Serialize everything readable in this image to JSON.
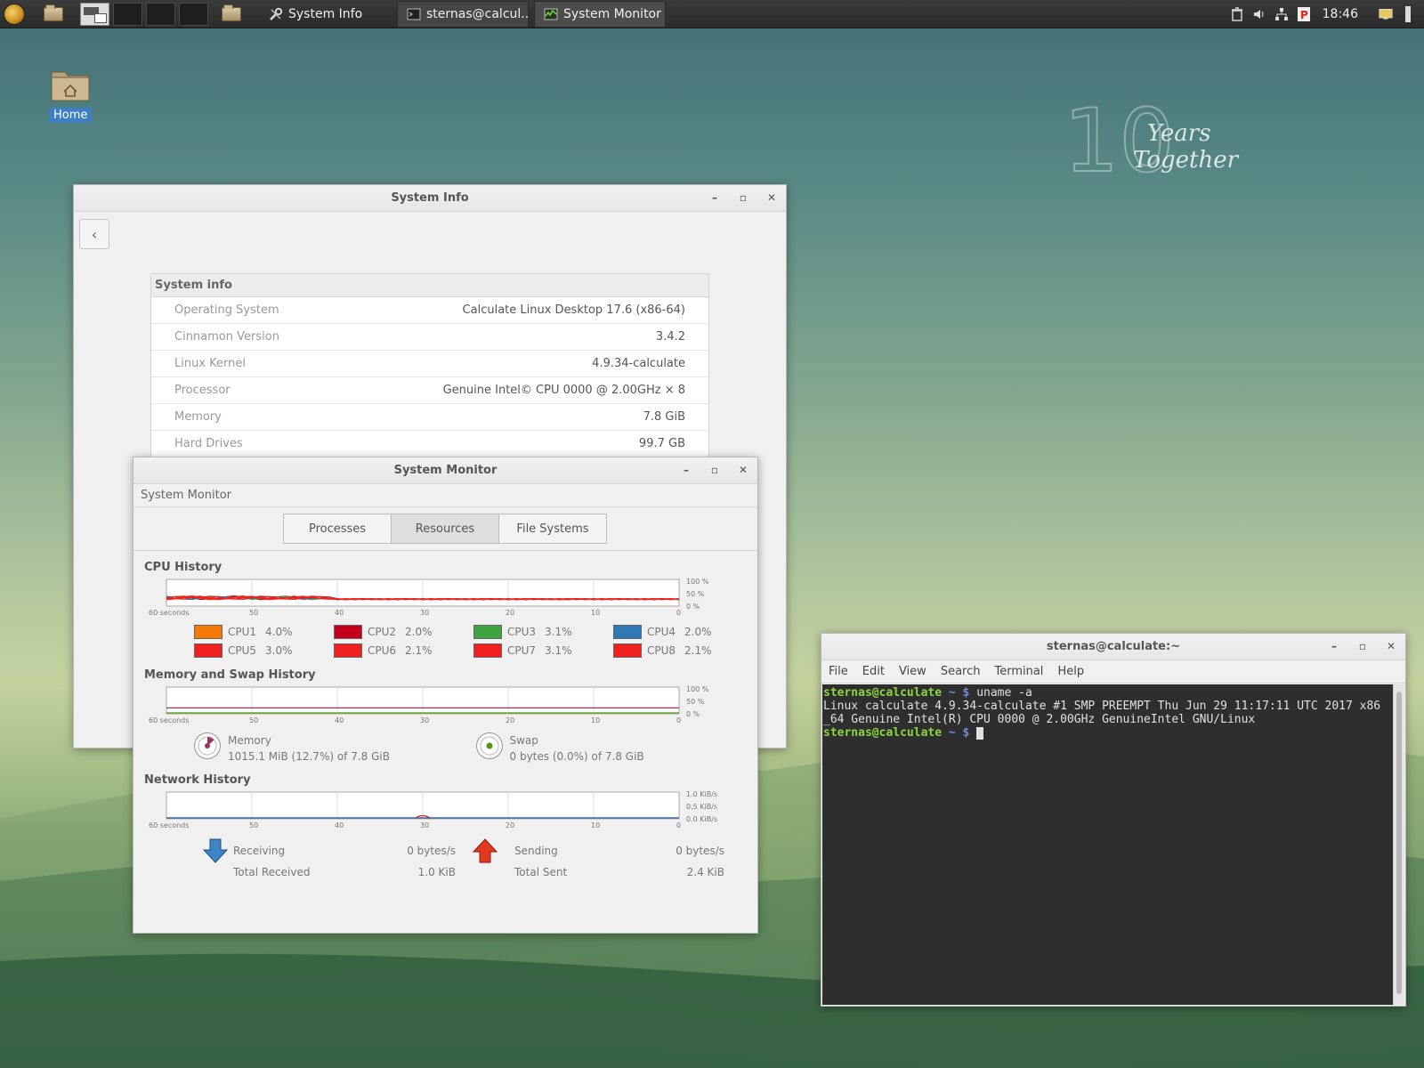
{
  "panel": {
    "tasks": [
      {
        "label": "System Info",
        "icon": "tools-icon"
      },
      {
        "label": "sternas@calcul...",
        "icon": "terminal-icon"
      },
      {
        "label": "System Monitor",
        "icon": "monitor-icon"
      }
    ],
    "clock": "18:46"
  },
  "desktop": {
    "home_label": "Home",
    "brand": {
      "number": "10",
      "line1": "Years",
      "line2": "Together"
    }
  },
  "sysinfo": {
    "title": "System Info",
    "section": "System info",
    "rows": [
      {
        "key": "Operating System",
        "value": "Calculate Linux Desktop 17.6 (x86-64)"
      },
      {
        "key": "Cinnamon Version",
        "value": "3.4.2"
      },
      {
        "key": "Linux Kernel",
        "value": "4.9.34-calculate"
      },
      {
        "key": "Processor",
        "value": "Genuine Intel© CPU 0000 @ 2.00GHz × 8"
      },
      {
        "key": "Memory",
        "value": "7.8 GiB"
      },
      {
        "key": "Hard Drives",
        "value": "99.7 GB"
      }
    ]
  },
  "sysmon": {
    "title": "System Monitor",
    "subtitle": "System Monitor",
    "tabs": [
      "Processes",
      "Resources",
      "File Systems"
    ],
    "active_tab": "Resources",
    "cpu": {
      "title": "CPU History",
      "x_ticks": [
        "60 seconds",
        "50",
        "40",
        "30",
        "20",
        "10",
        "0"
      ],
      "y_ticks": [
        "100 %",
        "50 %",
        "0 %"
      ],
      "cores": [
        {
          "name": "CPU1",
          "value": "4.0%",
          "color": "#f57900"
        },
        {
          "name": "CPU2",
          "value": "2.0%",
          "color": "#c4001c"
        },
        {
          "name": "CPU3",
          "value": "3.1%",
          "color": "#3fa33f"
        },
        {
          "name": "CPU4",
          "value": "2.0%",
          "color": "#2e78b6"
        },
        {
          "name": "CPU5",
          "value": "3.0%",
          "color": "#ef2020"
        },
        {
          "name": "CPU6",
          "value": "2.1%",
          "color": "#ef2020"
        },
        {
          "name": "CPU7",
          "value": "3.1%",
          "color": "#ef2020"
        },
        {
          "name": "CPU8",
          "value": "2.1%",
          "color": "#ef2020"
        }
      ]
    },
    "memory": {
      "title": "Memory and Swap History",
      "x_ticks": [
        "60 seconds",
        "50",
        "40",
        "30",
        "20",
        "10",
        "0"
      ],
      "y_ticks": [
        "100 %",
        "50 %",
        "0 %"
      ],
      "memory_label": "Memory",
      "memory_value": "1015.1 MiB (12.7%) of 7.8 GiB",
      "swap_label": "Swap",
      "swap_value": "0 bytes (0.0%) of 7.8 GiB",
      "memory_color": "#a03060",
      "swap_color": "#4e9a06"
    },
    "network": {
      "title": "Network History",
      "x_ticks": [
        "60 seconds",
        "50",
        "40",
        "30",
        "20",
        "10",
        "0"
      ],
      "y_ticks": [
        "1.0 KiB/s",
        "0.5 KiB/s",
        "0.0 KiB/s"
      ],
      "receiving_label": "Receiving",
      "receiving_value": "0 bytes/s",
      "total_received_label": "Total Received",
      "total_received_value": "1.0 KiB",
      "sending_label": "Sending",
      "sending_value": "0 bytes/s",
      "total_sent_label": "Total Sent",
      "total_sent_value": "2.4 KiB"
    }
  },
  "terminal": {
    "title": "sternas@calculate:~",
    "menu": [
      "File",
      "Edit",
      "View",
      "Search",
      "Terminal",
      "Help"
    ],
    "prompt_user": "sternas@calculate",
    "prompt_path": "~ $",
    "command": "uname -a",
    "output_line1": "Linux calculate 4.9.34-calculate #1 SMP PREEMPT Thu Jun 29 11:17:11 UTC 2017 x86",
    "output_line2": "_64 Genuine Intel(R) CPU 0000 @ 2.00GHz GenuineIntel GNU/Linux"
  }
}
